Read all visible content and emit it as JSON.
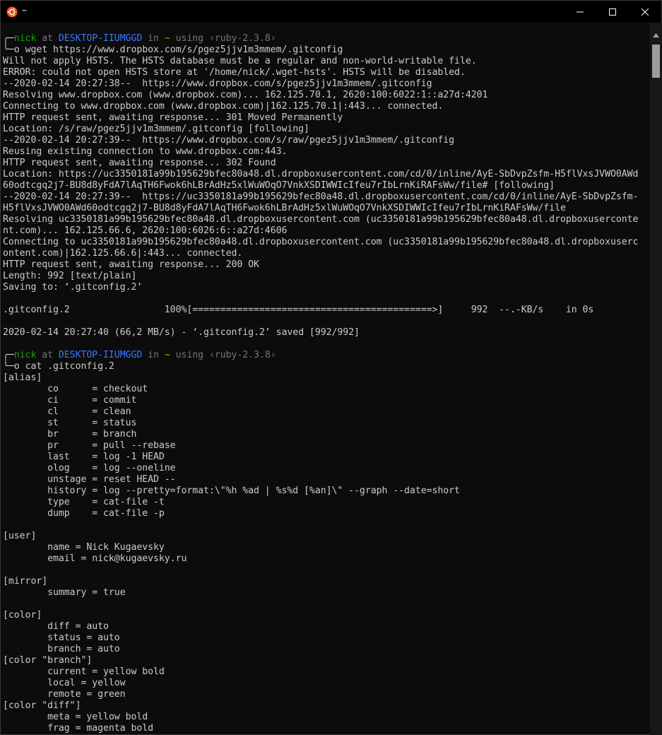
{
  "window": {
    "title": "~",
    "colors": {
      "accent_orange": "#e95420",
      "prompt_green": "#13a10e",
      "host_blue": "#3b78ff",
      "tilde_yellow": "#c19c00"
    }
  },
  "icons": {
    "app": "ubuntu-icon",
    "minimize": "minimize-icon",
    "maximize": "maximize-icon",
    "close": "close-icon",
    "scroll_up": "scroll-up-arrow-icon"
  },
  "prompts": [
    {
      "user": "nick",
      "at": " at ",
      "host": "DESKTOP-IIUMGGD",
      "in": " in ",
      "dir": "~",
      "using": " using ",
      "env": "‹ruby-2.3.8›",
      "corner": "╭─",
      "branch": "╰─",
      "symbol": "o ",
      "command": "wget https://www.dropbox.com/s/pgez5jjv1m3mmem/.gitconfig"
    },
    {
      "user": "nick",
      "at": " at ",
      "host": "DESKTOP-IIUMGGD",
      "in": " in ",
      "dir": "~",
      "using": " using ",
      "env": "‹ruby-2.3.8›",
      "corner": "╭─",
      "branch": "╰─",
      "symbol": "o ",
      "command": "cat .gitconfig.2"
    }
  ],
  "wget_output": [
    "Will not apply HSTS. The HSTS database must be a regular and non-world-writable file.",
    "ERROR: could not open HSTS store at '/home/nick/.wget-hsts'. HSTS will be disabled.",
    "--2020-02-14 20:27:38--  https://www.dropbox.com/s/pgez5jjv1m3mmem/.gitconfig",
    "Resolving www.dropbox.com (www.dropbox.com)... 162.125.70.1, 2620:100:6022:1::a27d:4201",
    "Connecting to www.dropbox.com (www.dropbox.com)|162.125.70.1|:443... connected.",
    "HTTP request sent, awaiting response... 301 Moved Permanently",
    "Location: /s/raw/pgez5jjv1m3mmem/.gitconfig [following]",
    "--2020-02-14 20:27:39--  https://www.dropbox.com/s/raw/pgez5jjv1m3mmem/.gitconfig",
    "Reusing existing connection to www.dropbox.com:443.",
    "HTTP request sent, awaiting response... 302 Found",
    "Location: https://uc3350181a99b195629bfec80a48.dl.dropboxusercontent.com/cd/0/inline/AyE-SbDvpZsfm-H5flVxsJVWO0AWd",
    "60odtcgq2j7-BU8d8yFdA7lAqTH6Fwok6hLBrAdHz5xlWuWOqO7VnkXSDIWWIcIfeu7rIbLrnKiRAFsWw/file# [following]",
    "--2020-02-14 20:27:39--  https://uc3350181a99b195629bfec80a48.dl.dropboxusercontent.com/cd/0/inline/AyE-SbDvpZsfm-",
    "H5flVxsJVWO0AWd60odtcgq2j7-BU8d8yFdA7lAqTH6Fwok6hLBrAdHz5xlWuWOqO7VnkXSDIWWIcIfeu7rIbLrnKiRAFsWw/file",
    "Resolving uc3350181a99b195629bfec80a48.dl.dropboxusercontent.com (uc3350181a99b195629bfec80a48.dl.dropboxuserconte",
    "nt.com)... 162.125.66.6, 2620:100:6026:6::a27d:4606",
    "Connecting to uc3350181a99b195629bfec80a48.dl.dropboxusercontent.com (uc3350181a99b195629bfec80a48.dl.dropboxuserc",
    "ontent.com)|162.125.66.6|:443... connected.",
    "HTTP request sent, awaiting response... 200 OK",
    "Length: 992 [text/plain]",
    "Saving to: ‘.gitconfig.2’",
    "",
    ".gitconfig.2                 100%[===========================================>]     992  --.-KB/s    in 0s",
    "",
    "2020-02-14 20:27:40 (66,2 MB/s) - ‘.gitconfig.2’ saved [992/992]",
    ""
  ],
  "cat_output": [
    "[alias]",
    "        co      = checkout",
    "        ci      = commit",
    "        cl      = clean",
    "        st      = status",
    "        br      = branch",
    "        pr      = pull --rebase",
    "        last    = log -1 HEAD",
    "        olog    = log --oneline",
    "        unstage = reset HEAD --",
    "        history = log --pretty=format:\\\"%h %ad | %s%d [%an]\\\" --graph --date=short",
    "        type    = cat-file -t",
    "        dump    = cat-file -p",
    "",
    "[user]",
    "        name = Nick Kugaevsky",
    "        email = nick@kugaevsky.ru",
    "",
    "[mirror]",
    "        summary = true",
    "",
    "[color]",
    "        diff = auto",
    "        status = auto",
    "        branch = auto",
    "[color \"branch\"]",
    "        current = yellow bold",
    "        local = yellow",
    "        remote = green",
    "[color \"diff\"]",
    "        meta = yellow bold",
    "        frag = magenta bold"
  ]
}
